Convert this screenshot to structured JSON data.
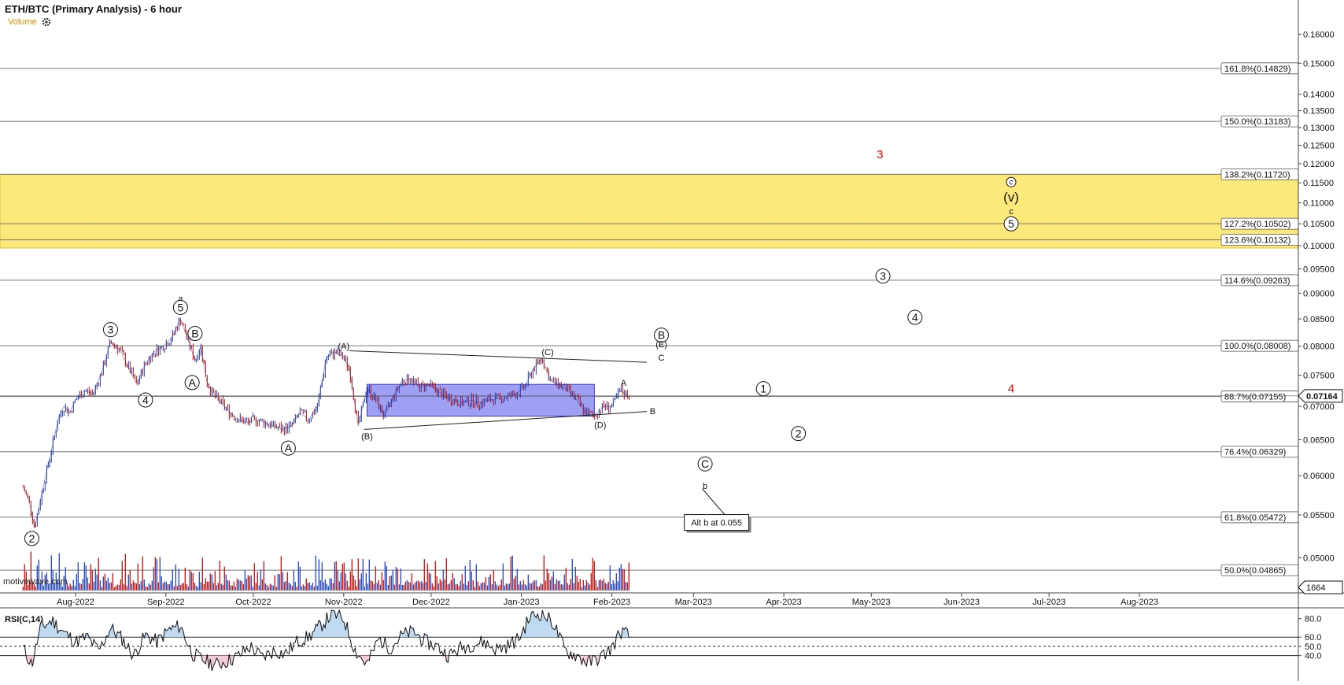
{
  "header": {
    "title": "ETH/BTC (Primary Analysis) - 6 hour",
    "volume_label": "Volume",
    "settings_icon": "gear-icon",
    "watermark": "motivewave.com"
  },
  "colors": {
    "zone_fill": "#fce97a",
    "zone_stroke": "#d9c23c",
    "box_fill": "#7f7ff0",
    "box_stroke": "#3a3ad0",
    "red_label": "#e00000",
    "bull_candle": "#1f3bb0",
    "bear_candle": "#b01010",
    "volume_bull": "#3050c0",
    "volume_bear": "#c02020",
    "volume_ma": "#f08020",
    "rsi_fill": "#bcd8f0",
    "rsi_fill_low": "#f4c8d4"
  },
  "chart_data": {
    "type": "line",
    "symbol": "ETH/BTC",
    "timeframe": "6 hour",
    "y_scale": "log",
    "ylim": [
      0.0465,
      0.172
    ],
    "x_ticks": [
      "Aug-2022",
      "Sep-2022",
      "Oct-2022",
      "Nov-2022",
      "Dec-2022",
      "Jan-2023",
      "Feb-2023",
      "Mar-2023",
      "Apr-2023",
      "May-2023",
      "Jun-2023",
      "Jul-2023",
      "Aug-2023"
    ],
    "y_ticks": [
      "0.16000",
      "0.15000",
      "0.14000",
      "0.13500",
      "0.13000",
      "0.12500",
      "0.12000",
      "0.11500",
      "0.11000",
      "0.10500",
      "0.10000",
      "0.09500",
      "0.09000",
      "0.08500",
      "0.08000",
      "0.07500",
      "0.07000",
      "0.06500",
      "0.06000",
      "0.05500",
      "0.05000"
    ],
    "last_price": "0.07164",
    "volume_last": "1664",
    "price_series": {
      "name": "",
      "x": [
        "2022-07-14",
        "2022-07-16",
        "2022-07-18",
        "2022-07-20",
        "2022-07-22",
        "2022-07-24",
        "2022-07-26",
        "2022-07-28",
        "2022-07-30",
        "2022-08-01",
        "2022-08-04",
        "2022-08-07",
        "2022-08-10",
        "2022-08-13",
        "2022-08-16",
        "2022-08-19",
        "2022-08-22",
        "2022-08-25",
        "2022-08-28",
        "2022-08-31",
        "2022-09-03",
        "2022-09-06",
        "2022-09-09",
        "2022-09-11",
        "2022-09-13",
        "2022-09-15",
        "2022-09-17",
        "2022-09-20",
        "2022-09-23",
        "2022-09-26",
        "2022-09-29",
        "2022-10-02",
        "2022-10-05",
        "2022-10-08",
        "2022-10-11",
        "2022-10-14",
        "2022-10-17",
        "2022-10-20",
        "2022-10-23",
        "2022-10-26",
        "2022-10-29",
        "2022-11-01",
        "2022-11-03",
        "2022-11-06",
        "2022-11-09",
        "2022-11-12",
        "2022-11-15",
        "2022-11-18",
        "2022-11-21",
        "2022-11-24",
        "2022-11-27",
        "2022-11-30",
        "2022-12-03",
        "2022-12-06",
        "2022-12-09",
        "2022-12-12",
        "2022-12-15",
        "2022-12-18",
        "2022-12-21",
        "2022-12-24",
        "2022-12-27",
        "2022-12-30",
        "2023-01-02",
        "2023-01-05",
        "2023-01-08",
        "2023-01-11",
        "2023-01-14",
        "2023-01-17",
        "2023-01-20",
        "2023-01-23",
        "2023-01-26",
        "2023-01-29",
        "2023-02-01",
        "2023-02-04",
        "2023-02-07"
      ],
      "y": [
        0.0585,
        0.0568,
        0.0535,
        0.057,
        0.0605,
        0.064,
        0.068,
        0.07,
        0.069,
        0.071,
        0.0725,
        0.072,
        0.0755,
        0.0808,
        0.0795,
        0.0765,
        0.0735,
        0.077,
        0.079,
        0.08,
        0.0815,
        0.085,
        0.0805,
        0.0775,
        0.08,
        0.074,
        0.072,
        0.0705,
        0.069,
        0.068,
        0.0675,
        0.068,
        0.0675,
        0.067,
        0.0665,
        0.067,
        0.069,
        0.068,
        0.07,
        0.078,
        0.079,
        0.078,
        0.076,
        0.067,
        0.073,
        0.071,
        0.0685,
        0.0715,
        0.074,
        0.0745,
        0.073,
        0.0735,
        0.0725,
        0.0715,
        0.071,
        0.0705,
        0.071,
        0.0705,
        0.071,
        0.0712,
        0.0715,
        0.072,
        0.073,
        0.076,
        0.078,
        0.074,
        0.0735,
        0.0725,
        0.071,
        0.069,
        0.0685,
        0.07,
        0.07,
        0.0725,
        0.0716
      ]
    },
    "rsi_series": {
      "name": "RSI(C,14)",
      "ylim": [
        15,
        90
      ],
      "ticks": [
        "80.0",
        "60.0",
        "50.0",
        "40.0"
      ],
      "levels": [
        60,
        50,
        40
      ],
      "x": [
        "2022-07-14",
        "2022-07-17",
        "2022-07-20",
        "2022-07-24",
        "2022-07-28",
        "2022-08-01",
        "2022-08-05",
        "2022-08-09",
        "2022-08-13",
        "2022-08-17",
        "2022-08-21",
        "2022-08-25",
        "2022-08-29",
        "2022-09-02",
        "2022-09-06",
        "2022-09-10",
        "2022-09-14",
        "2022-09-18",
        "2022-09-22",
        "2022-09-26",
        "2022-09-30",
        "2022-10-04",
        "2022-10-08",
        "2022-10-12",
        "2022-10-16",
        "2022-10-20",
        "2022-10-24",
        "2022-10-28",
        "2022-11-01",
        "2022-11-05",
        "2022-11-09",
        "2022-11-13",
        "2022-11-17",
        "2022-11-21",
        "2022-11-25",
        "2022-11-29",
        "2022-12-03",
        "2022-12-07",
        "2022-12-11",
        "2022-12-15",
        "2022-12-19",
        "2022-12-23",
        "2022-12-27",
        "2022-12-31",
        "2023-01-04",
        "2023-01-08",
        "2023-01-12",
        "2023-01-16",
        "2023-01-20",
        "2023-01-24",
        "2023-01-28",
        "2023-02-01",
        "2023-02-04",
        "2023-02-07"
      ],
      "y": [
        48,
        30,
        70,
        78,
        65,
        55,
        60,
        45,
        70,
        58,
        40,
        62,
        55,
        68,
        72,
        42,
        35,
        30,
        34,
        40,
        50,
        38,
        45,
        42,
        55,
        60,
        72,
        85,
        80,
        45,
        30,
        58,
        48,
        62,
        66,
        55,
        50,
        40,
        48,
        52,
        55,
        47,
        50,
        58,
        82,
        86,
        75,
        45,
        40,
        32,
        38,
        48,
        66,
        62
      ]
    },
    "fib_levels": [
      {
        "label": "161.8%(0.14829)",
        "value": 0.14829
      },
      {
        "label": "150.0%(0.13183)",
        "value": 0.13183
      },
      {
        "label": "138.2%(0.11720)",
        "value": 0.1172
      },
      {
        "label": "127.2%(0.10502)",
        "value": 0.10502
      },
      {
        "label": "123.6%(0.10132)",
        "value": 0.10132
      },
      {
        "label": "114.6%(0.09263)",
        "value": 0.09263
      },
      {
        "label": "100.0%(0.08008)",
        "value": 0.08008
      },
      {
        "label": "88.7%(0.07155)",
        "value": 0.07155
      },
      {
        "label": "76.4%(0.06329)",
        "value": 0.06329
      },
      {
        "label": "61.8%(0.05472)",
        "value": 0.05472
      },
      {
        "label": "50.0%(0.04865)",
        "value": 0.04865
      }
    ],
    "target_zone": {
      "from": 0.0995,
      "to": 0.1172
    },
    "consolidation_box": {
      "x0": "2022-11-09",
      "x1": "2023-01-26",
      "y0": 0.0685,
      "y1": 0.0735
    },
    "trendlines": [
      {
        "x0": "2022-11-03",
        "y0": 0.0792,
        "x1": "2023-02-13",
        "y1": 0.0772
      },
      {
        "x0": "2022-11-08",
        "y0": 0.0665,
        "x1": "2023-02-13",
        "y1": 0.0692
      }
    ],
    "wave_labels": [
      {
        "text": "2",
        "style": "circle",
        "x": "2022-07-17",
        "y": 0.0522
      },
      {
        "text": "3",
        "style": "circle",
        "x": "2022-08-13",
        "y": 0.083
      },
      {
        "text": "4",
        "style": "circle",
        "x": "2022-08-25",
        "y": 0.071
      },
      {
        "text": "a",
        "style": "plain",
        "x": "2022-09-06",
        "y": 0.089
      },
      {
        "text": "5",
        "style": "circle",
        "x": "2022-09-06",
        "y": 0.0872
      },
      {
        "text": "B",
        "style": "circle",
        "x": "2022-09-11",
        "y": 0.0823
      },
      {
        "text": "A",
        "style": "circle",
        "x": "2022-09-10",
        "y": 0.0738
      },
      {
        "text": "A",
        "style": "circle",
        "x": "2022-10-13",
        "y": 0.0638
      },
      {
        "text": "(A)",
        "style": "paren",
        "x": "2022-11-01",
        "y": 0.08
      },
      {
        "text": "(B)",
        "style": "paren",
        "x": "2022-11-09",
        "y": 0.0655
      },
      {
        "text": "(C)",
        "style": "paren",
        "x": "2023-01-10",
        "y": 0.079
      },
      {
        "text": "(D)",
        "style": "paren",
        "x": "2023-01-28",
        "y": 0.0672
      },
      {
        "text": "A",
        "style": "plain",
        "x": "2023-02-05",
        "y": 0.0738
      },
      {
        "text": "B",
        "style": "plain",
        "x": "2023-02-15",
        "y": 0.0693
      },
      {
        "text": "B",
        "style": "circle",
        "x": "2023-02-18",
        "y": 0.082
      },
      {
        "text": "(E)",
        "style": "paren",
        "x": "2023-02-18",
        "y": 0.0804
      },
      {
        "text": "C",
        "style": "plain",
        "x": "2023-02-18",
        "y": 0.078
      },
      {
        "text": "C",
        "style": "circle-c",
        "x": "2023-03-05",
        "y": 0.0616
      },
      {
        "text": "b",
        "style": "plain",
        "x": "2023-03-05",
        "y": 0.0587
      },
      {
        "text": "1",
        "style": "circle",
        "x": "2023-03-25",
        "y": 0.0728
      },
      {
        "text": "2",
        "style": "circle",
        "x": "2023-04-06",
        "y": 0.0659
      },
      {
        "text": "3",
        "style": "circle",
        "x": "2023-05-05",
        "y": 0.0935
      },
      {
        "text": "4",
        "style": "circle",
        "x": "2023-05-16",
        "y": 0.0853
      },
      {
        "text": "3",
        "style": "red",
        "x": "2023-05-04",
        "y": 0.1225
      },
      {
        "text": "4",
        "style": "red",
        "x": "2023-06-18",
        "y": 0.0728
      },
      {
        "text": "c",
        "style": "circle-small",
        "x": "2023-06-18",
        "y": 0.1152
      },
      {
        "text": "(v)",
        "style": "paren-big",
        "x": "2023-06-18",
        "y": 0.1115
      },
      {
        "text": "c",
        "style": "plain",
        "x": "2023-06-18",
        "y": 0.108
      },
      {
        "text": "5",
        "style": "circle",
        "x": "2023-06-18",
        "y": 0.105
      }
    ],
    "callout": {
      "text": "Alt b at 0.055",
      "x": "2023-03-10",
      "y": 0.0539,
      "pointer_from_x": "2023-03-04",
      "pointer_from_y": 0.0583
    }
  }
}
